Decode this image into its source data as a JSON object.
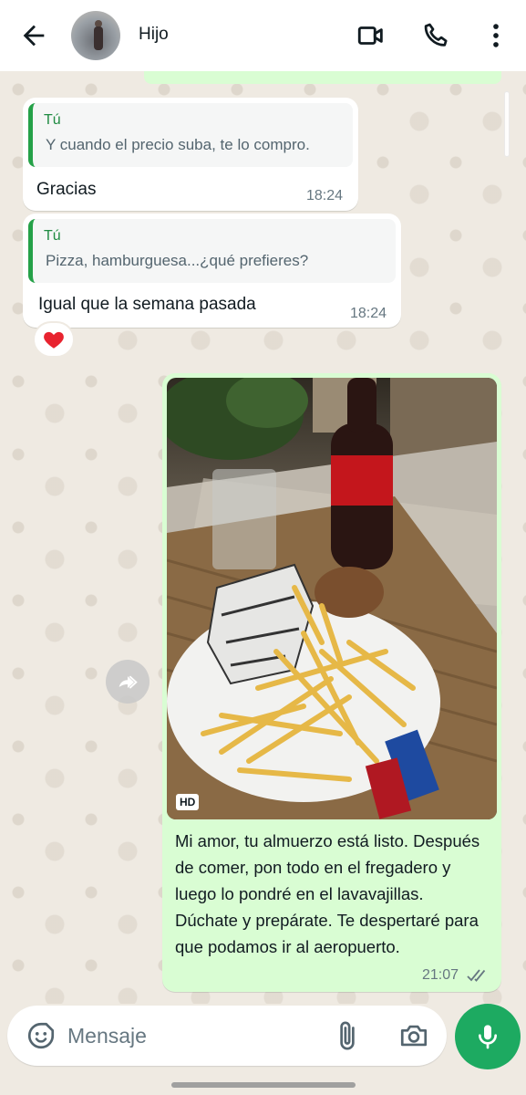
{
  "header": {
    "contact_name": "Hijo",
    "icons": [
      "back-arrow-icon",
      "video-call-icon",
      "phone-icon",
      "more-vert-icon"
    ]
  },
  "colors": {
    "header_bg": "#ffffff",
    "chat_bg": "#efeae2",
    "incoming_bubble": "#ffffff",
    "outgoing_bubble": "#d9fdd3",
    "accent_green": "#1daa61",
    "quote_bar": "#25a148"
  },
  "messages": [
    {
      "direction": "incoming",
      "quote_author": "Tú",
      "quote_text": "Y cuando el precio suba, te lo compro.",
      "text": "Gracias",
      "time": "18:24"
    },
    {
      "direction": "incoming",
      "quote_author": "Tú",
      "quote_text": "Pizza, hamburguesa...¿qué prefieres?",
      "text": "Igual que la semana pasada",
      "time": "18:24",
      "reaction": "❤️"
    },
    {
      "direction": "outgoing",
      "media": "photo",
      "media_badge": "HD",
      "caption": "Mi amor, tu almuerzo está listo. Después de comer, pon todo en el fregadero y luego lo pondré en el lavavajillas. Dúchate y prepárate. Te despertaré para que podamos ir al aeropuerto.",
      "time": "21:07",
      "status": "read-double-check"
    }
  ],
  "composer": {
    "placeholder": "Mensaje",
    "icons": [
      "sticker-icon",
      "attach-icon",
      "camera-icon",
      "mic-icon"
    ]
  }
}
